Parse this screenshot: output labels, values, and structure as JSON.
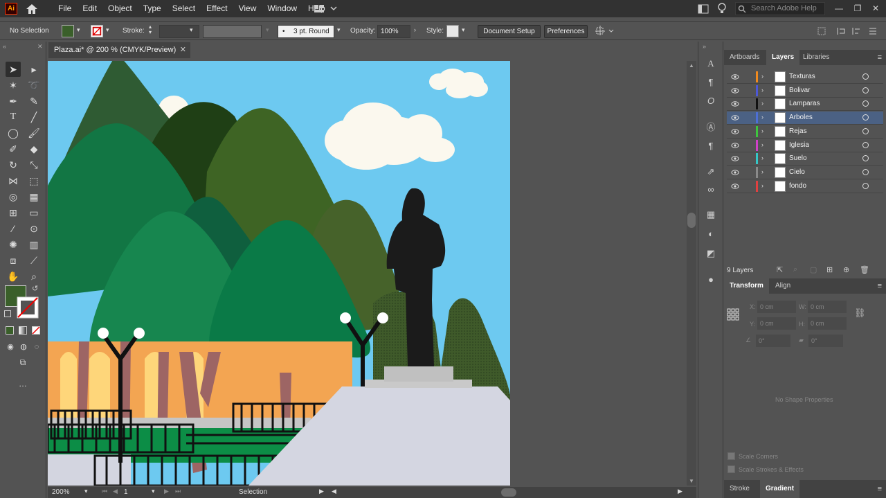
{
  "app": {
    "logo": "Ai"
  },
  "menu": [
    "File",
    "Edit",
    "Object",
    "Type",
    "Select",
    "Effect",
    "View",
    "Window",
    "Help"
  ],
  "search": {
    "placeholder": "Search Adobe Help"
  },
  "control": {
    "selection": "No Selection",
    "stroke_label": "Stroke:",
    "brush": "3 pt. Round",
    "opacity_label": "Opacity:",
    "opacity": "100%",
    "style_label": "Style:",
    "doc_setup": "Document Setup",
    "preferences": "Preferences"
  },
  "document": {
    "tab_title": "Plaza.ai* @ 200 % (CMYK/Preview)"
  },
  "status": {
    "zoom": "200%",
    "artboard": "1",
    "tool": "Selection"
  },
  "panels": {
    "tabs": [
      "Artboards",
      "Layers",
      "Libraries"
    ],
    "active_tab": "Layers",
    "layers": [
      {
        "name": "Texturas",
        "color": "#f08a1e"
      },
      {
        "name": "Bolivar",
        "color": "#4d58d6"
      },
      {
        "name": "Lamparas",
        "color": "#111111"
      },
      {
        "name": "Arboles",
        "color": "#4d6fd6",
        "selected": true
      },
      {
        "name": "Rejas",
        "color": "#3ec63e"
      },
      {
        "name": "Iglesia",
        "color": "#d040c8"
      },
      {
        "name": "Suelo",
        "color": "#35c7c7"
      },
      {
        "name": "Cielo",
        "color": "#8a8a8a"
      },
      {
        "name": "fondo",
        "color": "#e04040"
      }
    ],
    "layer_count": "9 Layers",
    "transform_tabs": [
      "Transform",
      "Align"
    ],
    "transform": {
      "x_label": "X:",
      "x": "0 cm",
      "y_label": "Y:",
      "y": "0 cm",
      "w_label": "W:",
      "w": "0 cm",
      "h_label": "H:",
      "h": "0 cm",
      "angle": "0°",
      "shear": "0°"
    },
    "no_shape": "No Shape Properties",
    "scale_corners": "Scale Corners",
    "scale_strokes": "Scale Strokes & Effects",
    "bottom_tabs": [
      "Stroke",
      "Gradient"
    ]
  },
  "colors": {
    "fill": "#3a5f2a",
    "accent": "#4b6184"
  }
}
